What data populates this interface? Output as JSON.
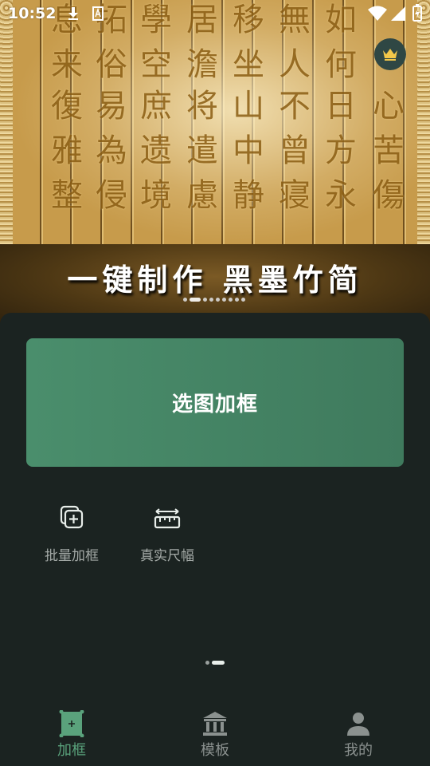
{
  "status_bar": {
    "time": "10:52"
  },
  "banner": {
    "headline": "一键制作  黑墨竹简",
    "slide_count": 9,
    "active_slide": 1
  },
  "main": {
    "primary_action": "选图加框",
    "tools": [
      {
        "label": "批量加框",
        "icon": "batch-frame-icon"
      },
      {
        "label": "真实尺幅",
        "icon": "ruler-icon"
      }
    ]
  },
  "tab_bar": {
    "tabs": [
      {
        "label": "加框",
        "icon": "frame-icon",
        "active": true
      },
      {
        "label": "模板",
        "icon": "template-icon",
        "active": false
      },
      {
        "label": "我的",
        "icon": "profile-icon",
        "active": false
      }
    ]
  },
  "colors": {
    "accent": "#4a8e6c",
    "background": "#1b2321",
    "active_tab": "#5aa27c"
  }
}
